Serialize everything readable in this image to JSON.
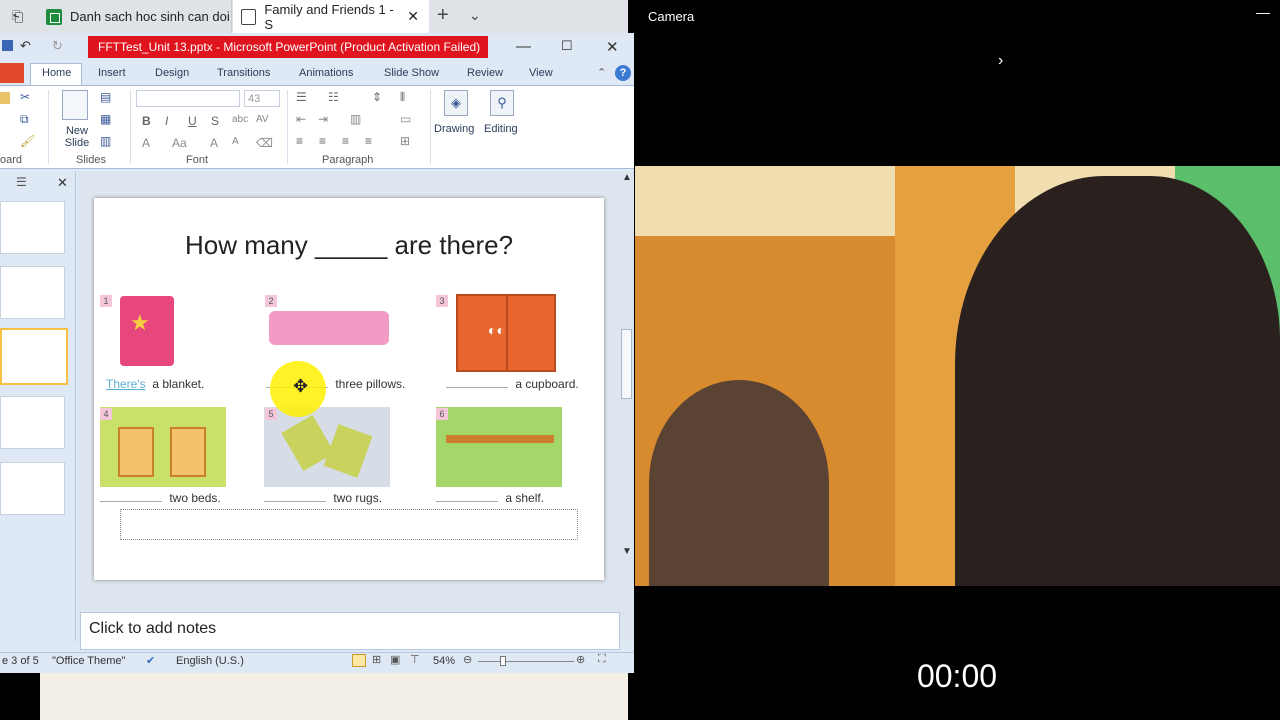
{
  "browser": {
    "tabs": [
      {
        "label": "Danh sach hoc sinh can doi"
      },
      {
        "label": "Family and Friends 1 - S"
      }
    ]
  },
  "ppt": {
    "window_title": "FFTTest_Unit 13.pptx  -  Microsoft PowerPoint (Product Activation Failed)",
    "ribbon_tabs": [
      "Home",
      "Insert",
      "Design",
      "Transitions",
      "Animations",
      "Slide Show",
      "Review",
      "View"
    ],
    "groups": {
      "clipboard": "oard",
      "slides": "Slides",
      "font": "Font",
      "paragraph": "Paragraph"
    },
    "buttons": {
      "new_slide": "New Slide",
      "drawing": "Drawing",
      "editing": "Editing"
    },
    "font_size": "43",
    "slide": {
      "title": "How many _____ are there?",
      "items": [
        {
          "num": "1",
          "fill": "There's",
          "text": "a blanket."
        },
        {
          "num": "2",
          "fill": "",
          "text": "three pillows."
        },
        {
          "num": "3",
          "fill": "",
          "text": "a cupboard."
        },
        {
          "num": "4",
          "fill": "",
          "text": "two beds."
        },
        {
          "num": "5",
          "fill": "",
          "text": "two rugs."
        },
        {
          "num": "6",
          "fill": "",
          "text": "a shelf."
        }
      ]
    },
    "notes_placeholder": "Click to add notes",
    "status": {
      "slide_of": "e 3 of 5",
      "theme": "\"Office Theme\"",
      "language": "English (U.S.)",
      "zoom": "54%"
    }
  },
  "camera": {
    "title": "Camera",
    "timer": "00:00"
  },
  "colors": {
    "title_bar_red": "#e0141e",
    "file_tab": "#e24a2b",
    "ribbon_bg": "#dfe8f5"
  }
}
